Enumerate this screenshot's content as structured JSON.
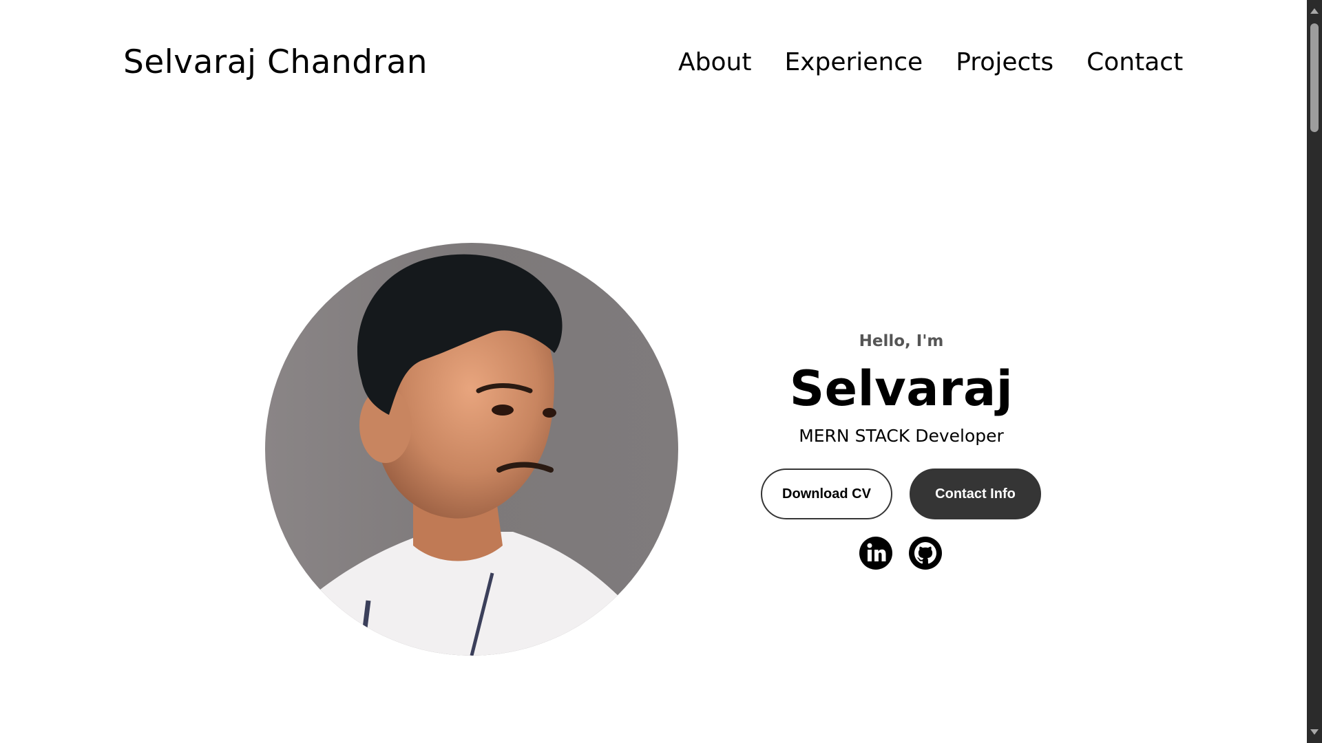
{
  "header": {
    "logo": "Selvaraj Chandran",
    "nav": [
      {
        "label": "About"
      },
      {
        "label": "Experience"
      },
      {
        "label": "Projects"
      },
      {
        "label": "Contact"
      }
    ]
  },
  "hero": {
    "greeting": "Hello, I'm",
    "name": "Selvaraj",
    "role": "MERN STACK Developer",
    "buttons": {
      "download_cv": "Download CV",
      "contact_info": "Contact Info"
    },
    "socials": {
      "linkedin": {
        "icon": "linkedin-icon"
      },
      "github": {
        "icon": "github-icon"
      }
    }
  },
  "colors": {
    "text": "#000000",
    "muted": "#555555",
    "button_dark": "#353535",
    "background": "#ffffff",
    "photo_background": "#7f7b7c"
  }
}
